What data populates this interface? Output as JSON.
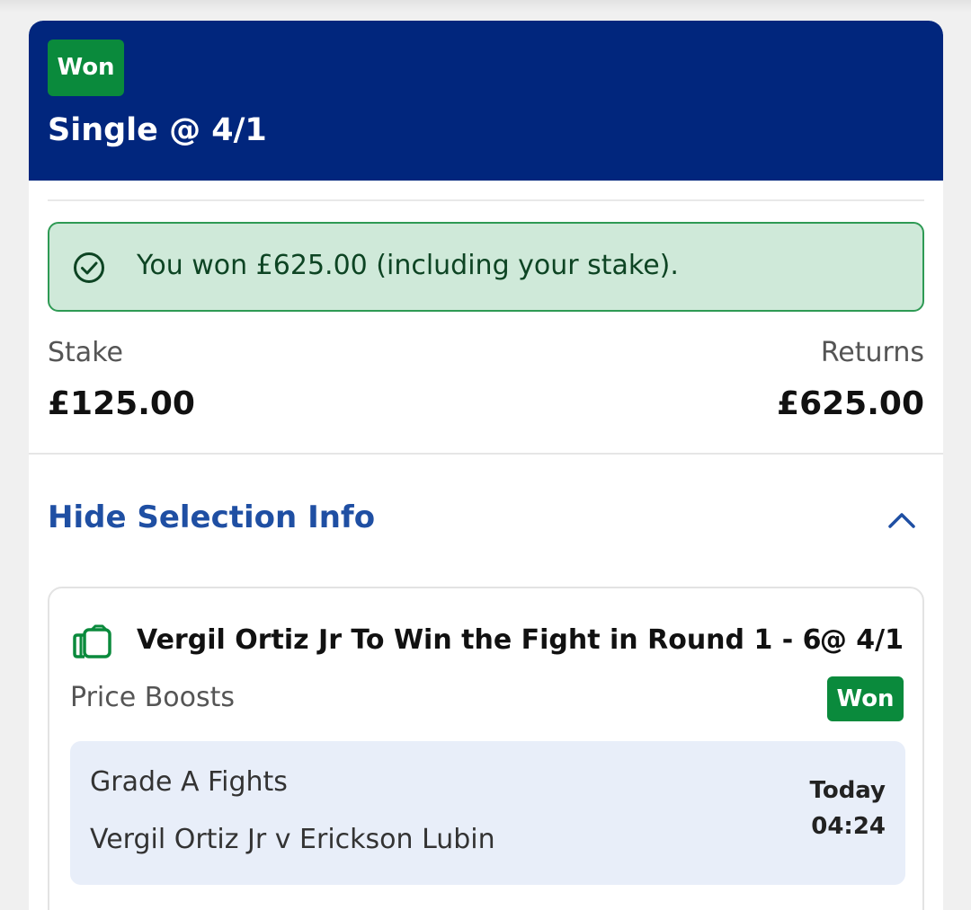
{
  "bet": {
    "status_badge": "Won",
    "title": "Single @ 4/1",
    "won_message": "You won £625.00 (including your stake).",
    "stake_label": "Stake",
    "stake_value": "£125.00",
    "returns_label": "Returns",
    "returns_value": "£625.00",
    "toggle_label": "Hide Selection Info"
  },
  "selection": {
    "name": "Vergil Ortiz Jr To Win the Fight in Round 1 - 6",
    "odds": "@ 4/1",
    "market": "Price Boosts",
    "status_badge": "Won",
    "league": "Grade A Fights",
    "fixture": "Vergil Ortiz Jr v Erickson Lubin",
    "day": "Today",
    "time": "04:24"
  },
  "colors": {
    "header_bg": "#01267d",
    "won_green": "#0a8a3c",
    "alert_bg": "#cfe9d9",
    "link_blue": "#1f4fa3",
    "event_bg": "#e8eef9"
  },
  "icons": {
    "alert": "check-circle-icon",
    "toggle": "chevron-up-icon",
    "selection": "price-boost-icon"
  }
}
